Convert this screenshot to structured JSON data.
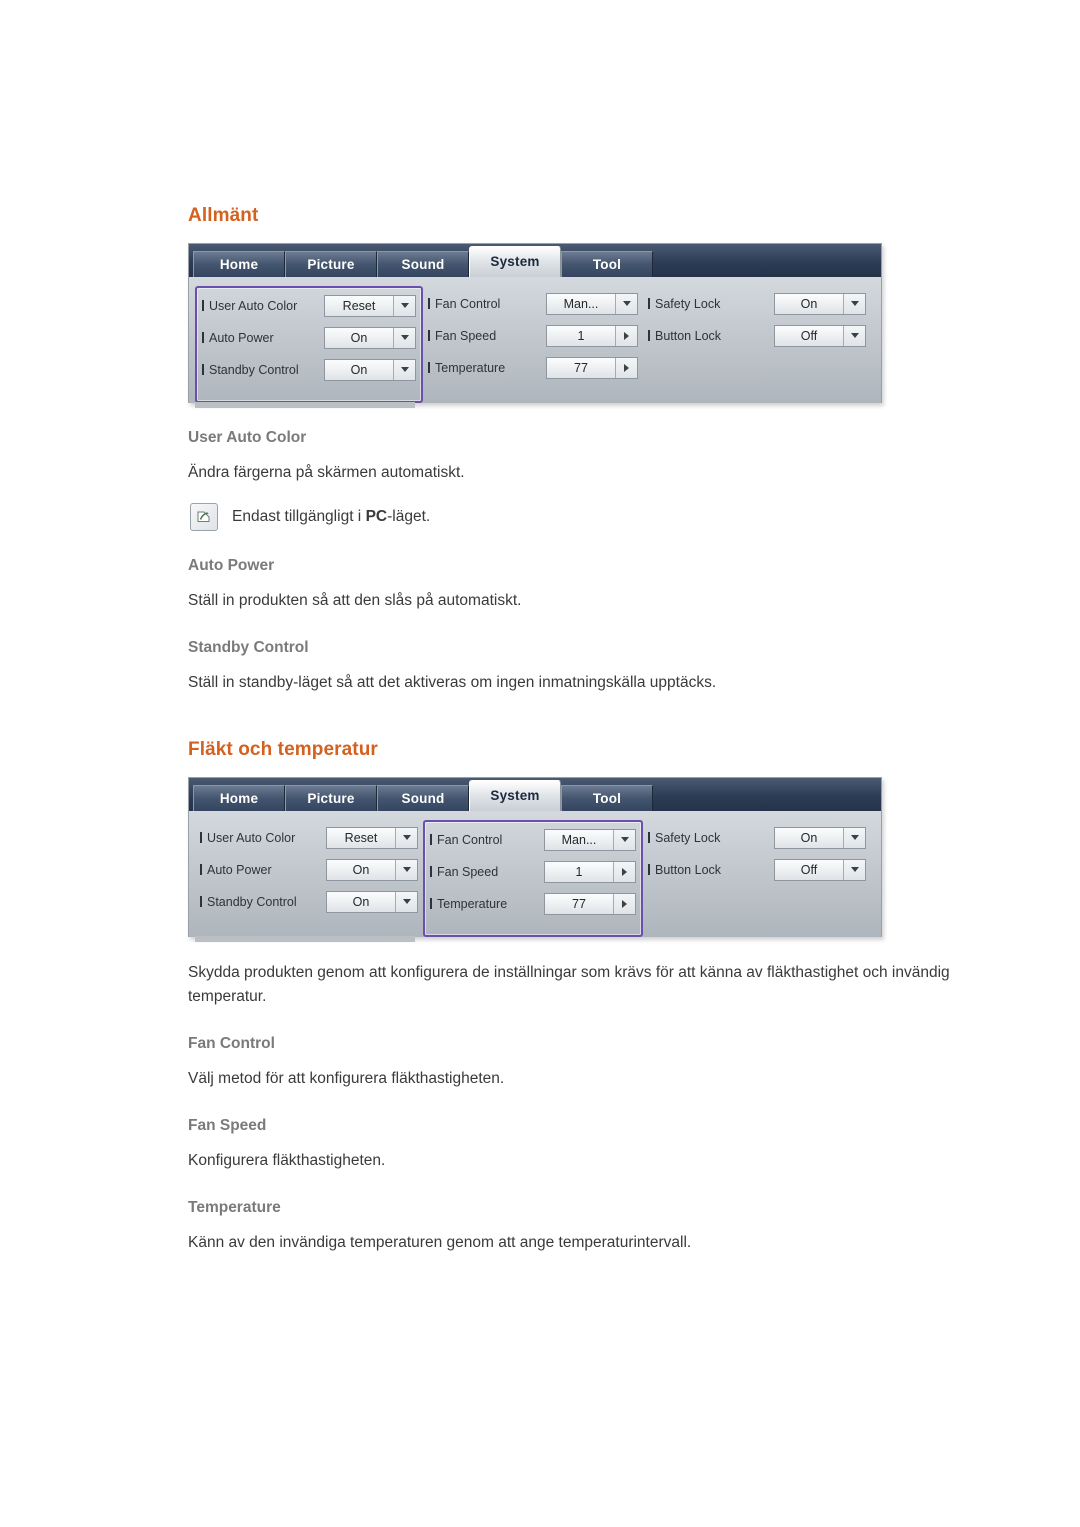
{
  "sections": [
    {
      "title": "Allmänt",
      "osd": {
        "tabs": [
          {
            "label": "Home",
            "active": false
          },
          {
            "label": "Picture",
            "active": false
          },
          {
            "label": "Sound",
            "active": false
          },
          {
            "label": "System",
            "active": true
          },
          {
            "label": "Tool",
            "active": false
          }
        ],
        "columns": [
          {
            "highlight": true,
            "rows": [
              {
                "label": "User Auto Color",
                "value": "Reset",
                "control": "dropdown"
              },
              {
                "label": "Auto Power",
                "value": "On",
                "control": "dropdown"
              },
              {
                "label": "Standby Control",
                "value": "On",
                "control": "dropdown"
              }
            ]
          },
          {
            "highlight": false,
            "rows": [
              {
                "label": "Fan Control",
                "value": "Man...",
                "control": "dropdown"
              },
              {
                "label": "Fan Speed",
                "value": "1",
                "control": "stepper"
              },
              {
                "label": "Temperature",
                "value": "77",
                "control": "stepper"
              }
            ]
          },
          {
            "highlight": false,
            "rows": [
              {
                "label": "Safety Lock",
                "value": "On",
                "control": "dropdown"
              },
              {
                "label": "Button Lock",
                "value": "Off",
                "control": "dropdown"
              }
            ]
          }
        ]
      },
      "blocks": [
        {
          "type": "heading",
          "text": "User Auto Color"
        },
        {
          "type": "paragraph",
          "text": "Ändra färgerna på skärmen automatiskt."
        },
        {
          "type": "note",
          "icon": "note-pencil-icon",
          "text_before": "Endast tillgängligt i ",
          "text_bold": "PC",
          "text_after": "-läget."
        },
        {
          "type": "heading",
          "text": "Auto Power"
        },
        {
          "type": "paragraph",
          "text": "Ställ in produkten så att den slås på automatiskt."
        },
        {
          "type": "heading",
          "text": "Standby Control"
        },
        {
          "type": "paragraph",
          "text": "Ställ in standby-läget så att det aktiveras om ingen inmatningskälla upptäcks."
        }
      ]
    },
    {
      "title": "Fläkt och temperatur",
      "osd": {
        "tabs": [
          {
            "label": "Home",
            "active": false
          },
          {
            "label": "Picture",
            "active": false
          },
          {
            "label": "Sound",
            "active": false
          },
          {
            "label": "System",
            "active": true
          },
          {
            "label": "Tool",
            "active": false
          }
        ],
        "columns": [
          {
            "highlight": false,
            "rows": [
              {
                "label": "User Auto Color",
                "value": "Reset",
                "control": "dropdown"
              },
              {
                "label": "Auto Power",
                "value": "On",
                "control": "dropdown"
              },
              {
                "label": "Standby Control",
                "value": "On",
                "control": "dropdown"
              }
            ]
          },
          {
            "highlight": true,
            "rows": [
              {
                "label": "Fan Control",
                "value": "Man...",
                "control": "dropdown"
              },
              {
                "label": "Fan Speed",
                "value": "1",
                "control": "stepper"
              },
              {
                "label": "Temperature",
                "value": "77",
                "control": "stepper"
              }
            ]
          },
          {
            "highlight": false,
            "rows": [
              {
                "label": "Safety Lock",
                "value": "On",
                "control": "dropdown"
              },
              {
                "label": "Button Lock",
                "value": "Off",
                "control": "dropdown"
              }
            ]
          }
        ]
      },
      "blocks": [
        {
          "type": "paragraph",
          "text": "Skydda produkten genom att konfigurera de inställningar som krävs för att känna av fläkthastighet och invändig temperatur."
        },
        {
          "type": "heading",
          "text": "Fan Control"
        },
        {
          "type": "paragraph",
          "text": "Välj metod för att konfigurera fläkthastigheten."
        },
        {
          "type": "heading",
          "text": "Fan Speed"
        },
        {
          "type": "paragraph",
          "text": "Konfigurera fläkthastigheten."
        },
        {
          "type": "heading",
          "text": "Temperature"
        },
        {
          "type": "paragraph",
          "text": "Känn av den invändiga temperaturen genom att ange temperaturintervall."
        }
      ]
    }
  ],
  "colors": {
    "section_title": "#d4611f",
    "sub_title": "#7a7a7a",
    "highlight_border": "#6a4fae"
  }
}
